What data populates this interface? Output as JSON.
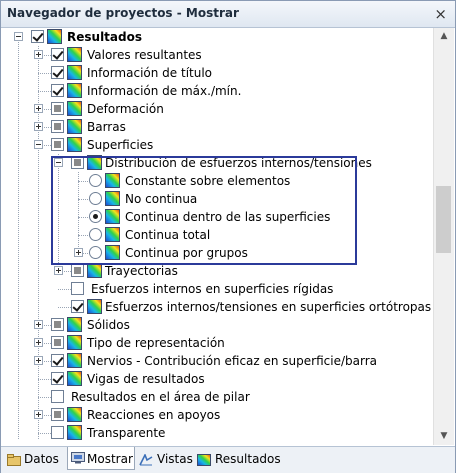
{
  "window": {
    "title": "Navegador de proyectos - Mostrar",
    "close_glyph": "×"
  },
  "tree": {
    "root": "Resultados",
    "items": [
      "Valores resultantes",
      "Información de título",
      "Información de máx./mín.",
      "Deformación",
      "Barras",
      "Superficies",
      "Distribución de esfuerzos internos/tensiones",
      "Constante sobre elementos",
      "No continua",
      "Continua dentro de las superficies",
      "Continua total",
      "Continua por grupos",
      "Trayectorias",
      "Esfuerzos internos en superficies rígidas",
      "Esfuerzos internos/tensiones en superficies ortótropas",
      "Sólidos",
      "Tipo de representación",
      "Nervios - Contribución eficaz en superficie/barra",
      "Vigas de resultados",
      "Resultados en el área de pilar",
      "Reacciones en apoyos",
      "Transparente"
    ]
  },
  "tabs": [
    "Datos",
    "Mostrar",
    "Vistas",
    "Resultados"
  ],
  "colors": {
    "highlight_border": "#2b3a9a"
  }
}
